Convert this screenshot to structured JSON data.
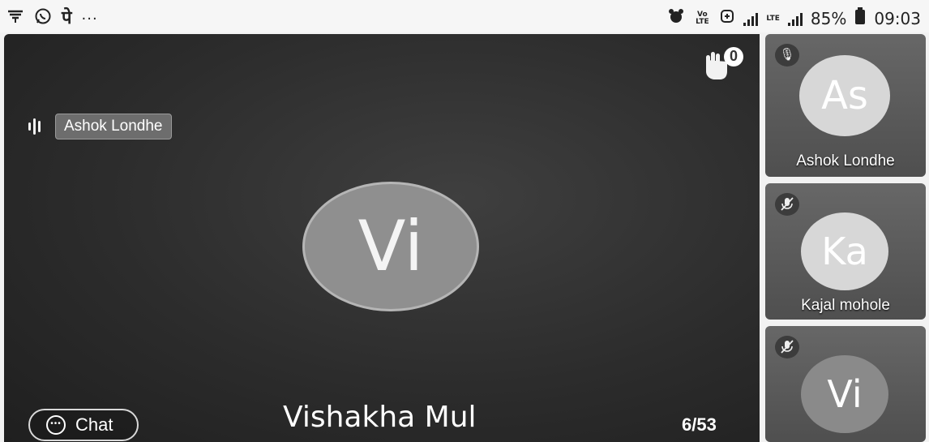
{
  "status_bar": {
    "left_icons": [
      "antenna-icon",
      "whatsapp-icon",
      "phonepe-icon"
    ],
    "dots": "···",
    "lte_label": "LTE",
    "volte_label": "Vo LTE",
    "battery": "85%",
    "time": "09:03"
  },
  "stage": {
    "active_speaker_tag": "Ashok Londhe",
    "hand_raise_count": "0",
    "main_avatar_initials": "Vi",
    "main_participant_name": "Vishakha Mul",
    "page_counter": "6/53",
    "chat_label": "Chat"
  },
  "side_tiles": [
    {
      "initials": "As",
      "name": "Ashok Londhe",
      "mic": "on"
    },
    {
      "initials": "Ka",
      "name": "Kajal mohole",
      "mic": "muted"
    },
    {
      "initials": "Vi",
      "name": "",
      "mic": "muted"
    }
  ]
}
